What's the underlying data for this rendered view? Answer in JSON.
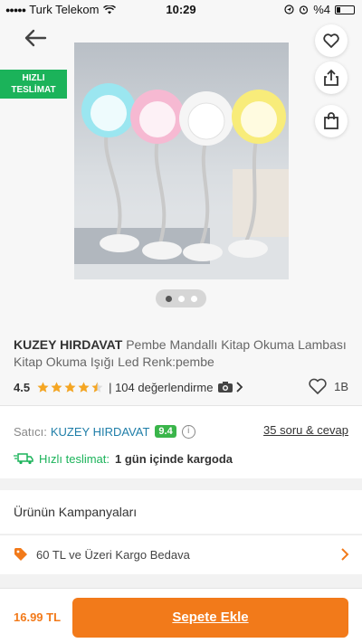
{
  "status_bar": {
    "carrier": "Turk Telekom",
    "time": "10:29",
    "battery": "%4"
  },
  "hero": {
    "badge_line1": "HIZLI",
    "badge_line2": "TESLİMAT",
    "icons": [
      "back-arrow-icon",
      "heart-icon",
      "share-icon",
      "shopping-bag-icon"
    ],
    "pager": {
      "count": 3,
      "active": 1
    }
  },
  "product": {
    "brand": "KUZEY HIRDAVAT",
    "name": "Pembe Mandallı Kitap Okuma Lambası Kitap Okuma Işığı Led Renk:pembe",
    "rating": "4.5",
    "stars_filled": 4.5,
    "review_count": "| 104 değerlendirme",
    "favorites": "1B"
  },
  "seller": {
    "label": "Satıcı:",
    "name": "KUZEY HIRDAVAT",
    "score": "9.4",
    "qa_link": "35 soru & cevap",
    "shipping_label": "Hızlı teslimat:",
    "shipping_value": "1 gün içinde kargoda"
  },
  "campaigns": {
    "title": "Ürünün Kampanyaları",
    "item": "60 TL ve Üzeri Kargo Bedava"
  },
  "bottom": {
    "price": "16.99 TL",
    "add_to_cart": "Sepete Ekle"
  },
  "colors": {
    "accent": "#f27a1a",
    "fast_green": "#1bb35a",
    "seller_blue": "#1f7ea8",
    "star": "#f5a623"
  }
}
